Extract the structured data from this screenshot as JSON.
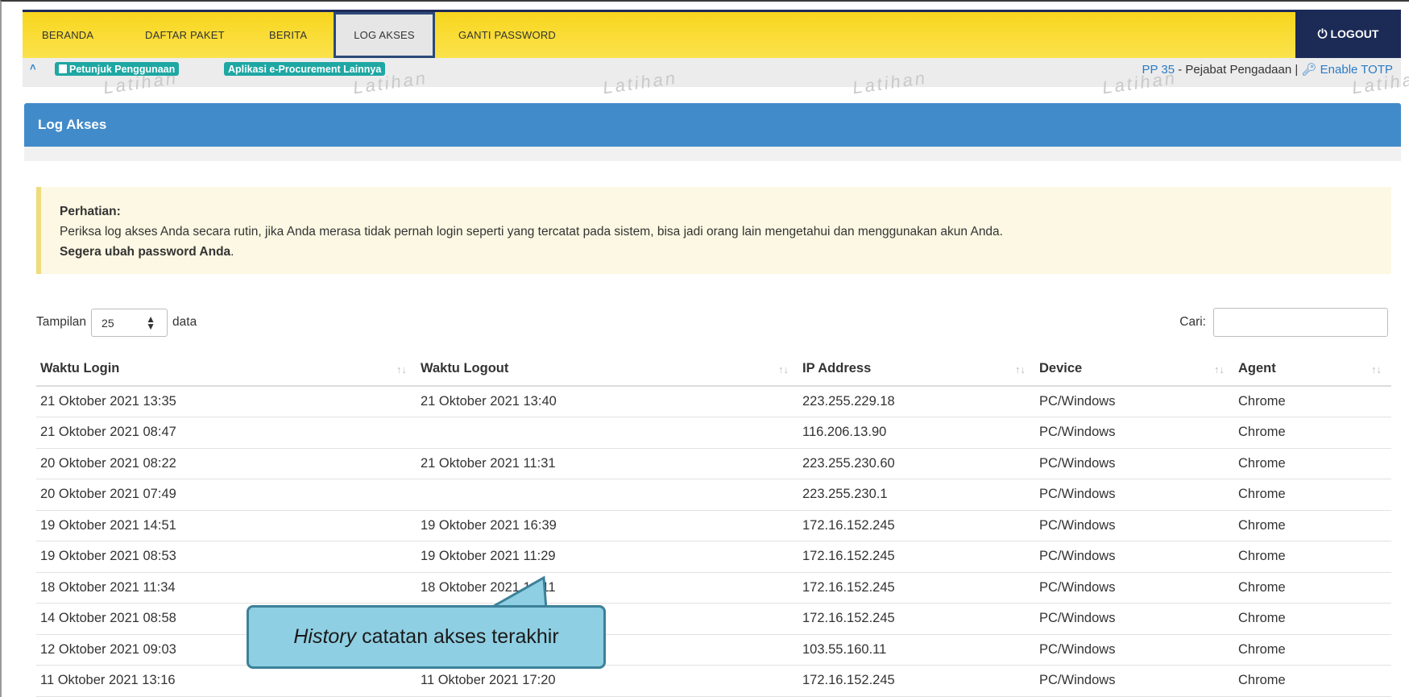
{
  "nav": {
    "items": [
      "BERANDA",
      "DAFTAR PAKET",
      "BERITA",
      "LOG AKSES",
      "GANTI PASSWORD"
    ],
    "active": "LOG AKSES",
    "logout": "LOGOUT"
  },
  "subbar": {
    "petunjuk": "Petunjuk Penggunaan",
    "aplikasi": "Aplikasi e-Procurement Lainnya",
    "pp": "PP 35",
    "role": " - Pejabat Pengadaan | ",
    "totp": "Enable TOTP",
    "watermark": "Latihan"
  },
  "panel": {
    "title": "Log Akses"
  },
  "alert": {
    "title": "Perhatian:",
    "body": "Periksa log akses Anda secara rutin, jika Anda merasa tidak pernah login seperti yang tercatat pada sistem, bisa jadi orang lain mengetahui dan menggunakan akun Anda.",
    "emph": "Segera ubah password Anda",
    "emph_tail": "."
  },
  "controls": {
    "tampilan_label": "Tampilan",
    "page_size": "25",
    "data_label": "data",
    "search_label": "Cari:"
  },
  "table": {
    "headers": [
      "Waktu Login",
      "Waktu Logout",
      "IP Address",
      "Device",
      "Agent"
    ],
    "rows": [
      [
        "21 Oktober 2021 13:35",
        "21 Oktober 2021 13:40",
        "223.255.229.18",
        "PC/Windows",
        "Chrome"
      ],
      [
        "21 Oktober 2021 08:47",
        "",
        "116.206.13.90",
        "PC/Windows",
        "Chrome"
      ],
      [
        "20 Oktober 2021 08:22",
        "21 Oktober 2021 11:31",
        "223.255.230.60",
        "PC/Windows",
        "Chrome"
      ],
      [
        "20 Oktober 2021 07:49",
        "",
        "223.255.230.1",
        "PC/Windows",
        "Chrome"
      ],
      [
        "19 Oktober 2021 14:51",
        "19 Oktober 2021 16:39",
        "172.16.152.245",
        "PC/Windows",
        "Chrome"
      ],
      [
        "19 Oktober 2021 08:53",
        "19 Oktober 2021 11:29",
        "172.16.152.245",
        "PC/Windows",
        "Chrome"
      ],
      [
        "18 Oktober 2021 11:34",
        "18 Oktober 2021 12:11",
        "172.16.152.245",
        "PC/Windows",
        "Chrome"
      ],
      [
        "14 Oktober 2021 08:58",
        "",
        "172.16.152.245",
        "PC/Windows",
        "Chrome"
      ],
      [
        "12 Oktober 2021 09:03",
        "",
        "103.55.160.11",
        "PC/Windows",
        "Chrome"
      ],
      [
        "11 Oktober 2021 13:16",
        "11 Oktober 2021 17:20",
        "172.16.152.245",
        "PC/Windows",
        "Chrome"
      ]
    ]
  },
  "callout": {
    "italic": "History",
    "rest": " catatan akses terakhir"
  }
}
